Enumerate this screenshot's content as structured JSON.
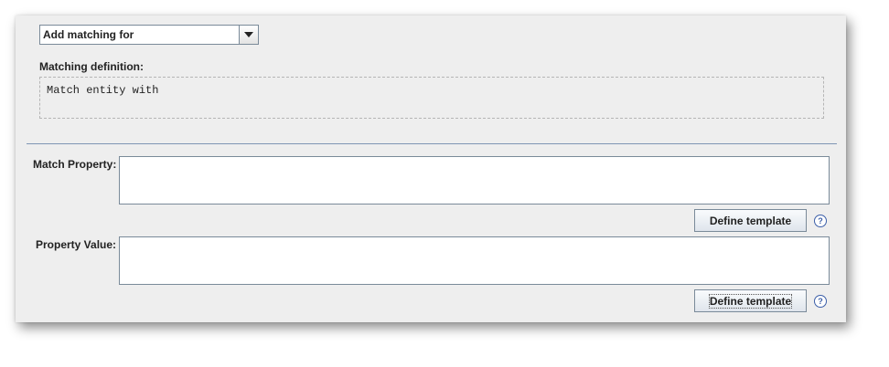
{
  "matching": {
    "combo_value": "Add matching for",
    "definition_label": "Matching definition:",
    "definition_text": "Match entity with"
  },
  "fields": [
    {
      "label": "Match Property:",
      "value": "",
      "button_label": "Define template",
      "help_icon": "question-mark-icon",
      "help_glyph": "?"
    },
    {
      "label": "Property Value:",
      "value": "",
      "button_label": "Define template",
      "help_icon": "question-mark-icon",
      "help_glyph": "?"
    }
  ],
  "colors": {
    "panel_bg": "#eeeeee",
    "separator": "#7f96b4",
    "help_icon": "#3b5ea8"
  }
}
